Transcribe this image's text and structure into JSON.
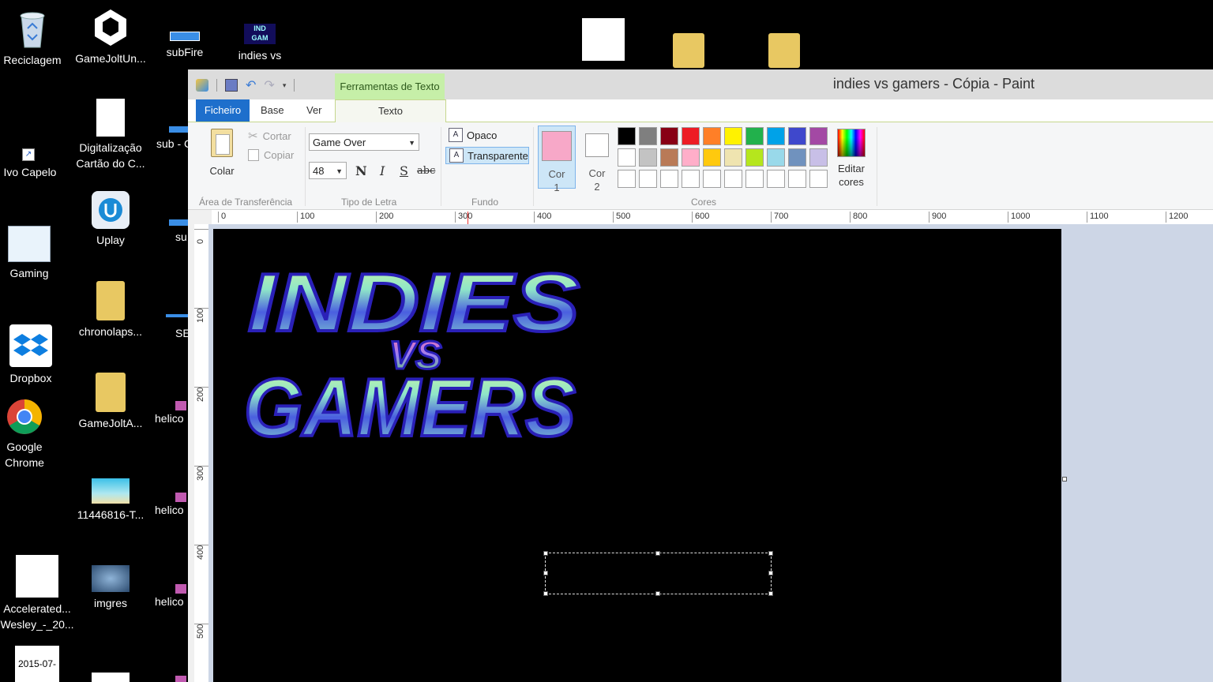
{
  "desktop": {
    "icons": [
      {
        "label": "Reciclagem"
      },
      {
        "label": "GameJoltUn..."
      },
      {
        "label": "subFire"
      },
      {
        "label": "indies vs"
      },
      {
        "label": "Ivo Capelo"
      },
      {
        "label": "Digitalização Cartão do C..."
      },
      {
        "label": "sub - C"
      },
      {
        "label": "Uplay"
      },
      {
        "label": "su"
      },
      {
        "label": "Gaming"
      },
      {
        "label": "chronolaps..."
      },
      {
        "label": "SE"
      },
      {
        "label": "Dropbox"
      },
      {
        "label": "GameJoltA..."
      },
      {
        "label": "helico"
      },
      {
        "label": "Google Chrome"
      },
      {
        "label": "11446816-T..."
      },
      {
        "label": "helico"
      },
      {
        "label": "Accelerated... Wesley_-_20..."
      },
      {
        "label": "imgres"
      },
      {
        "label": "helico"
      },
      {
        "label": "2015-07-"
      }
    ]
  },
  "window": {
    "title": "indies vs gamers - Cópia - Paint",
    "context_tab_header": "Ferramentas de Texto"
  },
  "tabs": {
    "file": "Ficheiro",
    "base": "Base",
    "view": "Ver",
    "text": "Texto"
  },
  "ribbon": {
    "clipboard": {
      "paste": "Colar",
      "cut": "Cortar",
      "copy": "Copiar",
      "label": "Área de Transferência"
    },
    "font": {
      "family": "Game Over",
      "size": "48",
      "bold": "N",
      "italic": "I",
      "underline": "S",
      "strike": "abc",
      "label": "Tipo de Letra"
    },
    "background": {
      "opaque": "Opaco",
      "transparent": "Transparente",
      "label": "Fundo"
    },
    "colors": {
      "color1_label": "Cor 1",
      "color2_label": "Cor 2",
      "color1": "#f7a8c8",
      "color2": "#ffffff",
      "palette": [
        "#000000",
        "#7f7f7f",
        "#880015",
        "#ed1c24",
        "#ff7f27",
        "#fff200",
        "#22b14c",
        "#00a2e8",
        "#3f48cc",
        "#a349a4",
        "#ffffff",
        "#c3c3c3",
        "#b97a57",
        "#ffaec9",
        "#ffc90e",
        "#efe4b0",
        "#b5e61d",
        "#99d9ea",
        "#7092be",
        "#c8bfe7",
        "#ffffff",
        "#ffffff",
        "#ffffff",
        "#ffffff",
        "#ffffff",
        "#ffffff",
        "#ffffff",
        "#ffffff",
        "#ffffff",
        "#ffffff"
      ],
      "edit": "Editar cores",
      "label": "Cores"
    }
  },
  "rulers": {
    "horizontal": [
      "0",
      "100",
      "200",
      "300",
      "400",
      "500",
      "600",
      "700",
      "800",
      "900",
      "1000",
      "1100",
      "1200"
    ],
    "vertical": [
      "0",
      "100",
      "200",
      "300",
      "400",
      "500"
    ]
  },
  "canvas": {
    "logo_line1": "INDIES",
    "logo_line2": "VS",
    "logo_line3": "GAMERS"
  }
}
